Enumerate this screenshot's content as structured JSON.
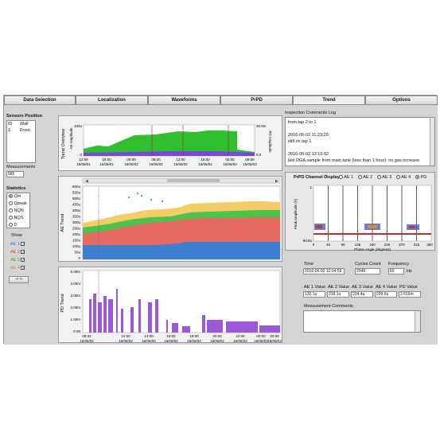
{
  "tabs": [
    "Data Selection",
    "Localization",
    "Waveforms",
    "PrPD",
    "Trend",
    "Options"
  ],
  "active_tab": "Trend",
  "sensors": {
    "title": "Sensors Position",
    "headers": [
      "ID",
      "Wall"
    ],
    "rows": [
      [
        "1.",
        "Front"
      ]
    ]
  },
  "measurements": {
    "label": "Measurements",
    "value": "585"
  },
  "statistics": {
    "title": "Statistics",
    "options": [
      "Qm",
      "Qpeak",
      "NQN",
      "NQS",
      "D"
    ],
    "selected": "Qm"
  },
  "show": {
    "label": "Show",
    "items": [
      {
        "label": "AE 1",
        "color": "#3a6fd8",
        "checked": true
      },
      {
        "label": "AE 2",
        "color": "#d83a3a",
        "checked": true
      },
      {
        "label": "AE 3",
        "color": "#2fb82f",
        "checked": true
      },
      {
        "label": "AE 4",
        "color": "#e0861f",
        "checked": true
      }
    ],
    "nav_button": "-> <-"
  },
  "overview": {
    "ylabel": "Trend Overview",
    "left_axis": "AE Amplitude",
    "right_axis": "PD Amplitude",
    "left_ticks": [
      "100u",
      "0"
    ],
    "right_ticks": [
      "30.0m",
      "0.0"
    ],
    "x_ticks": [
      {
        "t": "12:58",
        "d": "16/06/01"
      },
      {
        "t": "18:00",
        "d": "16/06/01"
      },
      {
        "t": "00:00",
        "d": "16/06/02"
      },
      {
        "t": "06:00",
        "d": "16/06/02"
      },
      {
        "t": "12:00",
        "d": "16/06/02"
      },
      {
        "t": "18:00",
        "d": "16/06/02"
      },
      {
        "t": "00:00",
        "d": "16/06/03"
      },
      {
        "t": "08:08",
        "d": "16/06/03"
      }
    ]
  },
  "ae_trend": {
    "ylabel": "AE Trend",
    "y_ticks": [
      "600u",
      "550u",
      "500u",
      "450u",
      "400u",
      "350u",
      "300u",
      "250u",
      "200u",
      "150u",
      "100u",
      "50u",
      "0"
    ]
  },
  "pd_trend": {
    "ylabel": "PD Trend",
    "y_ticks": [
      "5.00m",
      "4.00m",
      "3.00m",
      "2.00m",
      "1.00m",
      "0.00"
    ],
    "x_ticks": [
      {
        "t": "08:32",
        "d": "16/06/02"
      },
      {
        "t": "12:00",
        "d": "16/06/02"
      },
      {
        "t": "14:00",
        "d": "16/06/02"
      },
      {
        "t": "16:00",
        "d": "16/06/02"
      },
      {
        "t": "18:00",
        "d": "16/06/02"
      },
      {
        "t": "20:00",
        "d": "16/06/02"
      },
      {
        "t": "22:00",
        "d": "16/06/02"
      },
      {
        "t": "00:00",
        "d": "16/06/03"
      },
      {
        "t": "00:58",
        "d": "16/06/03"
      }
    ]
  },
  "comments_log": {
    "title": "Inspection Comments Log",
    "lines": [
      "from tap 2 to 1",
      "",
      "2016-06-02 11:23:29",
      "still on tap 1",
      "",
      "2016-06-02 13:10:02",
      "last DGA sample from main tank (less than 1 hour): no gas increase"
    ]
  },
  "prpd": {
    "title": "PrPD Channel Display",
    "channels": [
      "AE 1",
      "AE 2",
      "AE 3",
      "AE 4",
      "PD"
    ],
    "selected": "PD",
    "ylabel": "Peak Amplitude (V)",
    "xlabel": "Phase Angle (degrees)",
    "y_top": "1",
    "y_bottom": "90.8u",
    "x_ticks": [
      "0",
      "45",
      "90",
      "135",
      "180",
      "225",
      "270",
      "315",
      "360"
    ]
  },
  "info": {
    "time_label": "Time",
    "time_value": "2016-06-02 12:14:59",
    "cycles_label": "Cycles Count",
    "cycles_value": "2048",
    "freq_label": "Frequency",
    "freq_value": "60",
    "freq_unit": "Hz",
    "values": [
      {
        "label": "AE 1 Value",
        "value": "120.1u"
      },
      {
        "label": "AE 2 Value",
        "value": "218.1u"
      },
      {
        "label": "AE 3 Value",
        "value": "234.4u"
      },
      {
        "label": "AE 4 Value",
        "value": "299.6u"
      },
      {
        "label": "PD Value",
        "value": "2.616m"
      }
    ],
    "comments_label": "Measurement Comments"
  }
}
